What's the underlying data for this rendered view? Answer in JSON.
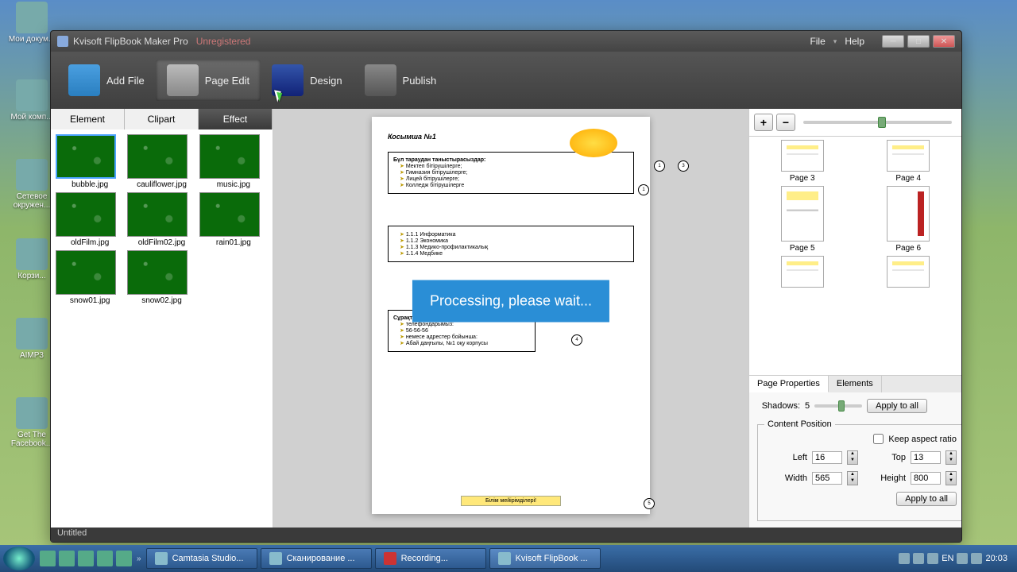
{
  "desktop": {
    "icons": [
      "Мои докум...",
      "",
      "",
      "",
      "",
      "Мой комп...",
      "Сетевое окружен...",
      "Корзи...",
      "AIMP3",
      "Get The Facebook..."
    ]
  },
  "app": {
    "title": "Kvisoft FlipBook Maker Pro",
    "unregistered": "Unregistered",
    "menu": {
      "file": "File",
      "help": "Help"
    },
    "toolbar": {
      "addFile": "Add File",
      "pageEdit": "Page Edit",
      "design": "Design",
      "publish": "Publish"
    },
    "leftTabs": {
      "element": "Element",
      "clipart": "Clipart",
      "effect": "Effect"
    },
    "effects": [
      "bubble.jpg",
      "cauliflower.jpg",
      "music.jpg",
      "oldFilm.jpg",
      "oldFilm02.jpg",
      "rain01.jpg",
      "snow01.jpg",
      "snow02.jpg"
    ],
    "processing": "Processing, please wait...",
    "pageDoc": {
      "title": "Косымша №1",
      "box1_header": "Бүл тараудан таныстырасыздар:",
      "box1_items": [
        "Мектеп бітірушілерге;",
        "Гимназия бітірушілерге;",
        "Лицей бітірушілерге;",
        "Колледж бітірушілерге"
      ],
      "box2_items": [
        "1.1.1   Информатика",
        "1.1.2   Экономика",
        "1.1.3   Медико-профилактикалық",
        "1.1.4   Медбике"
      ],
      "box3_header": "Сұрақтар бойынша хабарласыңыздар",
      "box3_items": [
        "телефондарымыз:",
        "56-56-56",
        "немесе адрестер бойынша:",
        "Абай даңғылы, №1 оқу корпусы"
      ],
      "banner": "Білім мейірімділері!"
    },
    "thumbs": [
      "Page 3",
      "Page 4",
      "Page 5",
      "Page 6"
    ],
    "propTabs": {
      "pageProps": "Page Properties",
      "elements": "Elements"
    },
    "props": {
      "shadowsLabel": "Shadows:",
      "shadows": "5",
      "applyAll": "Apply to all",
      "contentPos": "Content Position",
      "keepAspect": "Keep aspect ratio",
      "leftLabel": "Left",
      "left": "16",
      "topLabel": "Top",
      "top": "13",
      "widthLabel": "Width",
      "width": "565",
      "heightLabel": "Height",
      "height": "800"
    },
    "status": "Untitled"
  },
  "taskbar": {
    "items": [
      "Camtasia Studio...",
      "Сканирование ...",
      "Recording...",
      "Kvisoft FlipBook ..."
    ],
    "lang": "EN",
    "time": "20:03"
  }
}
